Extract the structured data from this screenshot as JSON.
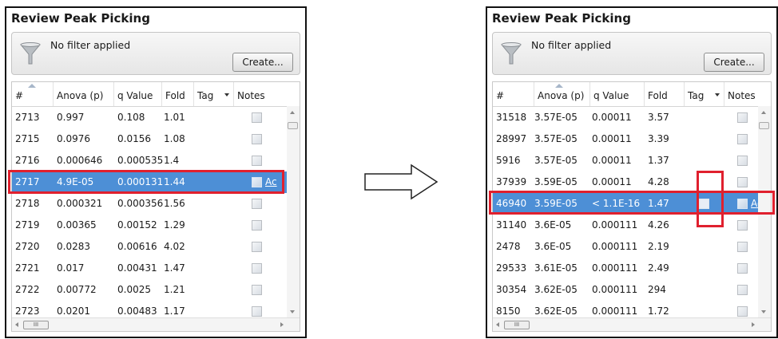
{
  "left_panel": {
    "title": "Review Peak Picking",
    "filter_text": "No filter applied",
    "create_label": "Create...",
    "columns": [
      "#",
      "Anova (p)",
      "q Value",
      "Fold",
      "Tag",
      "Notes"
    ],
    "sorted_column": "#",
    "rows": [
      {
        "id": "2713",
        "anova": "0.997",
        "q": "0.108",
        "fold": "1.01"
      },
      {
        "id": "2715",
        "anova": "0.0976",
        "q": "0.0156",
        "fold": "1.08"
      },
      {
        "id": "2716",
        "anova": "0.000646",
        "q": "0.000535",
        "fold": "1.4"
      },
      {
        "id": "2717",
        "anova": "4.9E-05",
        "q": "0.000131",
        "fold": "1.44",
        "selected": true,
        "link": "Ac"
      },
      {
        "id": "2718",
        "anova": "0.000321",
        "q": "0.000356",
        "fold": "1.56"
      },
      {
        "id": "2719",
        "anova": "0.00365",
        "q": "0.00152",
        "fold": "1.29"
      },
      {
        "id": "2720",
        "anova": "0.0283",
        "q": "0.00616",
        "fold": "4.02"
      },
      {
        "id": "2721",
        "anova": "0.017",
        "q": "0.00431",
        "fold": "1.47"
      },
      {
        "id": "2722",
        "anova": "0.00772",
        "q": "0.0025",
        "fold": "1.21"
      },
      {
        "id": "2723",
        "anova": "0.0201",
        "q": "0.00483",
        "fold": "1.17"
      }
    ],
    "hscroll_thumb": "III"
  },
  "right_panel": {
    "title": "Review Peak Picking",
    "filter_text": "No filter applied",
    "create_label": "Create...",
    "columns": [
      "#",
      "Anova (p)",
      "q Value",
      "Fold",
      "Tag",
      "Notes"
    ],
    "sorted_column": "Anova (p)",
    "rows": [
      {
        "id": "31518",
        "anova": "3.57E-05",
        "q": "0.00011",
        "fold": "3.57"
      },
      {
        "id": "28997",
        "anova": "3.57E-05",
        "q": "0.00011",
        "fold": "3.39"
      },
      {
        "id": "5916",
        "anova": "3.57E-05",
        "q": "0.00011",
        "fold": "1.37"
      },
      {
        "id": "37939",
        "anova": "3.59E-05",
        "q": "0.00011",
        "fold": "4.28"
      },
      {
        "id": "46940",
        "anova": "3.59E-05",
        "q": "< 1.1E-16",
        "fold": "1.47",
        "selected": true,
        "link": "Ac"
      },
      {
        "id": "31140",
        "anova": "3.6E-05",
        "q": "0.000111",
        "fold": "4.26"
      },
      {
        "id": "2478",
        "anova": "3.6E-05",
        "q": "0.000111",
        "fold": "2.19"
      },
      {
        "id": "29533",
        "anova": "3.61E-05",
        "q": "0.000111",
        "fold": "2.49"
      },
      {
        "id": "30354",
        "anova": "3.62E-05",
        "q": "0.000111",
        "fold": "294"
      },
      {
        "id": "8150",
        "anova": "3.62E-05",
        "q": "0.000111",
        "fold": "1.72"
      }
    ],
    "hscroll_thumb": "III"
  },
  "colors": {
    "selection": "#4d8fd6",
    "highlight_box": "#e0202e"
  },
  "icons": {
    "filter": "funnel-icon",
    "notes": "note-icon",
    "transition": "right-arrow-icon"
  }
}
